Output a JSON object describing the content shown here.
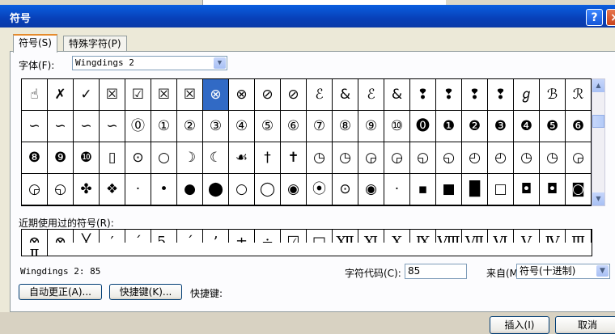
{
  "dialog": {
    "title": "符号",
    "help": "?",
    "close": "×"
  },
  "tabs": [
    {
      "label": "符号(S)"
    },
    {
      "label": "特殊字符(P)"
    }
  ],
  "font": {
    "label": "字体(F):",
    "value": "Wingdings 2"
  },
  "symbols": [
    "☝",
    "✗",
    "✓",
    "☒",
    "☑",
    "☒",
    "☒",
    "⊗",
    "⊗",
    "⊘",
    "⊘",
    "ℰ",
    "&",
    "ℰ",
    "&",
    "❢",
    "❢",
    "❢",
    "❢",
    "ℊ",
    "ℬ",
    "ℛ",
    "∽",
    "∽",
    "∽",
    "∽",
    "⓪",
    "①",
    "②",
    "③",
    "④",
    "⑤",
    "⑥",
    "⑦",
    "⑧",
    "⑨",
    "⑩",
    "⓿",
    "❶",
    "❷",
    "❸",
    "❹",
    "❺",
    "❻",
    "❽",
    "❾",
    "❿",
    "▯",
    "⊙",
    "○",
    "☽",
    "☾",
    "☙",
    "†",
    "✝",
    "◷",
    "◷",
    "◶",
    "◶",
    "◵",
    "◵",
    "◴",
    "◴",
    "◷",
    "◷",
    "◶",
    "◶",
    "◵",
    "✤",
    "❖",
    "·",
    "•",
    "●",
    "⬤",
    "○",
    "◯",
    "◉",
    "⦿",
    "⊙",
    "◉",
    "·",
    "▪",
    "■",
    "█",
    "□",
    "◘",
    "◘",
    "◙",
    "◙",
    "◘"
  ],
  "selected_index": 7,
  "recent": {
    "label": "近期使用过的符号(R):",
    "items": [
      "⊗",
      "⊗",
      "╳",
      "′",
      "´",
      "5.",
      "ˊ",
      "’",
      "±",
      "÷",
      "☑",
      "□",
      "Ⅻ",
      "Ⅺ",
      "Ⅹ",
      "Ⅸ",
      "Ⅷ",
      "Ⅶ",
      "Ⅵ",
      "Ⅴ",
      "Ⅳ",
      "Ⅲ",
      "Ⅱ"
    ]
  },
  "font_code": "Wingdings 2: 85",
  "char_code": {
    "label": "字符代码(C):",
    "value": "85"
  },
  "from": {
    "label": "来自(M):",
    "value": "符号(十进制)"
  },
  "buttons": {
    "autocorrect": "自动更正(A)...",
    "shortcut_key": "快捷键(K)...",
    "shortcut_label": "快捷键:",
    "insert": "插入(I)",
    "cancel": "取消"
  }
}
